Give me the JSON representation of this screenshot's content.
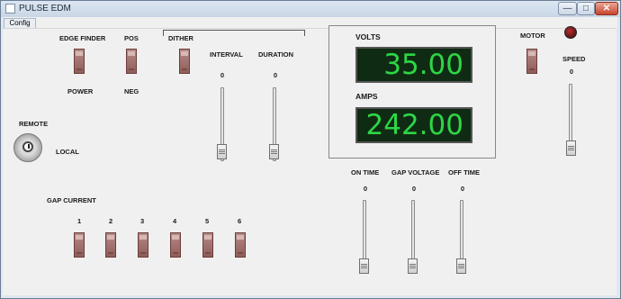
{
  "window": {
    "title": "PULSE EDM",
    "min_glyph": "—",
    "max_glyph": "□",
    "close_glyph": "✕"
  },
  "menu": {
    "config": "Config"
  },
  "switches": {
    "edge_finder": "EDGE FINDER",
    "power": "POWER",
    "pos": "POS",
    "neg": "NEG",
    "dither": "DITHER",
    "motor": "MOTOR",
    "remote": "REMOTE",
    "local": "LOCAL"
  },
  "sliders": {
    "interval": {
      "label": "INTERVAL",
      "value": "0"
    },
    "duration": {
      "label": "DURATION",
      "value": "0"
    },
    "speed": {
      "label": "SPEED",
      "value": "0"
    },
    "on_time": {
      "label": "ON TIME",
      "value": "0"
    },
    "gap_voltage": {
      "label": "GAP VOLTAGE",
      "value": "0"
    },
    "off_time": {
      "label": "OFF TIME",
      "value": "0"
    }
  },
  "readouts": {
    "volts": {
      "label": "VOLTS",
      "value": "35.00"
    },
    "amps": {
      "label": "AMPS",
      "value": "242.00"
    }
  },
  "gap_current": {
    "label": "GAP CURRENT",
    "channels": [
      "1",
      "2",
      "3",
      "4",
      "5",
      "6"
    ]
  },
  "colors": {
    "readout_bg": "#102b13",
    "readout_text": "#2dd646",
    "toggle": "#8f5d5a",
    "led": "#b42e2e"
  }
}
